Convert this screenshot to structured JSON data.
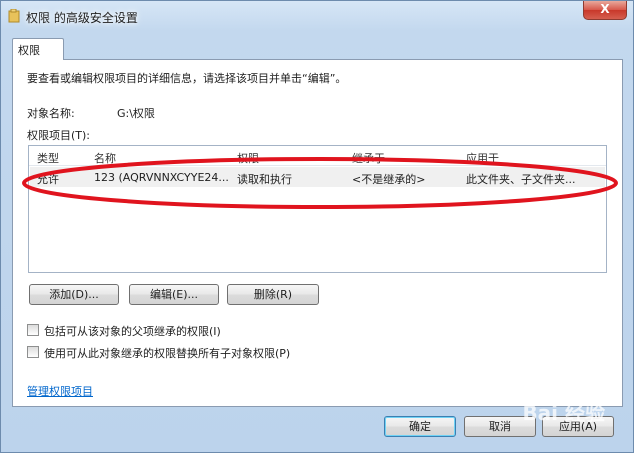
{
  "window": {
    "title": "权限 的高级安全设置",
    "close_label": "X"
  },
  "tab": {
    "label": "权限"
  },
  "instruction": "要查看或编辑权限项目的详细信息，请选择该项目并单击“编辑”。",
  "object_name": {
    "label": "对象名称:",
    "value": "G:\\权限"
  },
  "items_label": "权限项目(T):",
  "list": {
    "columns": [
      "类型",
      "名称",
      "权限",
      "继承于",
      "应用于"
    ],
    "rows": [
      {
        "type": "允许",
        "name": "123 (AQRVNNXCYYE24...",
        "permission": "读取和执行",
        "inherited_from": "<不是继承的>",
        "applies_to": "此文件夹、子文件夹..."
      }
    ]
  },
  "buttons": {
    "add": "添加(D)...",
    "edit": "编辑(E)...",
    "remove": "删除(R)",
    "ok": "确定",
    "cancel": "取消",
    "apply": "应用(A)"
  },
  "checkboxes": [
    {
      "label": "包括可从该对象的父项继承的权限(I)",
      "checked": false
    },
    {
      "label": "使用可从此对象继承的权限替换所有子对象权限(P)",
      "checked": false
    }
  ],
  "manage_link": "管理权限项目",
  "watermark": "Bai 经验",
  "colors": {
    "annotation": "#e0141e",
    "link": "#0066cc"
  }
}
